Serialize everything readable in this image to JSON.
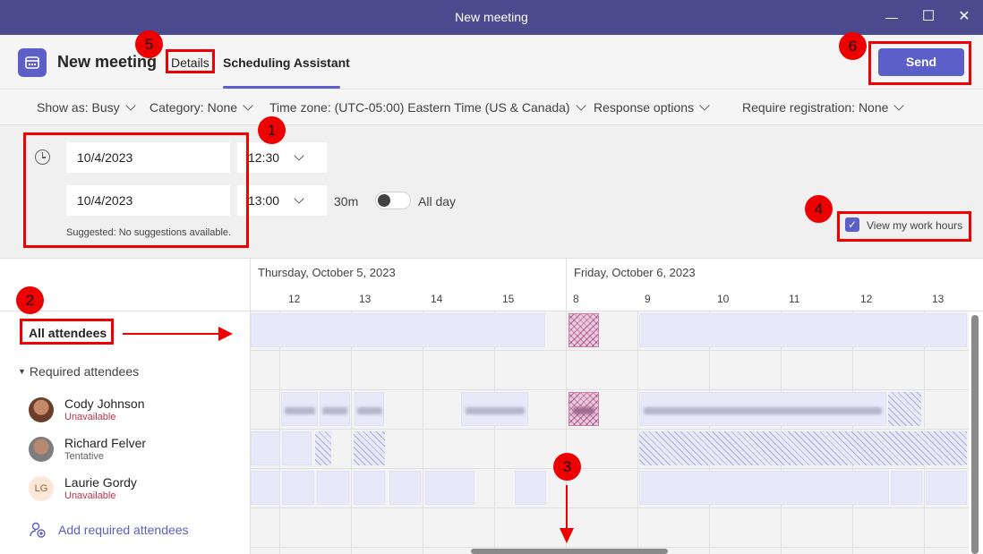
{
  "window": {
    "title": "New meeting",
    "minimize": "—",
    "maximize": "☐",
    "close": "✕"
  },
  "header": {
    "title": "New meeting",
    "tabs": [
      {
        "label": "Details"
      },
      {
        "label": "Scheduling Assistant"
      }
    ],
    "send_label": "Send"
  },
  "options": {
    "show_as": "Show as: Busy",
    "category": "Category: None",
    "timezone": "Time zone: (UTC-05:00) Eastern Time (US & Canada)",
    "response": "Response options",
    "registration": "Require registration: None"
  },
  "form": {
    "start_date": "10/4/2023",
    "start_time": "12:30",
    "end_date": "10/4/2023",
    "end_time": "13:00",
    "duration": "30m",
    "all_day": "All day",
    "suggested": "Suggested: No suggestions available.",
    "view_work_hours": "View my work hours"
  },
  "schedule": {
    "day1": "Thursday, October 5, 2023",
    "day2": "Friday, October 6, 2023",
    "day1_hours": [
      "12",
      "13",
      "14",
      "15"
    ],
    "day2_hours": [
      "8",
      "9",
      "10",
      "11",
      "12",
      "13"
    ],
    "all_attendees": "All attendees",
    "required_attendees": "Required attendees",
    "attendees": [
      {
        "name": "Cody Johnson",
        "status": "Unavailable",
        "status_color": "#c4314b"
      },
      {
        "name": "Richard Felver",
        "status": "Tentative",
        "status_color": "#616161"
      },
      {
        "name": "Laurie Gordy",
        "status": "Unavailable",
        "status_color": "#c4314b",
        "initials": "LG"
      }
    ],
    "add_attendees": "Add required attendees"
  },
  "annotations": [
    "1",
    "2",
    "3",
    "4",
    "5",
    "6"
  ],
  "colors": {
    "accent": "#5b5fc7",
    "titlebar": "#4b4a8f",
    "annotation": "#ee0000"
  }
}
